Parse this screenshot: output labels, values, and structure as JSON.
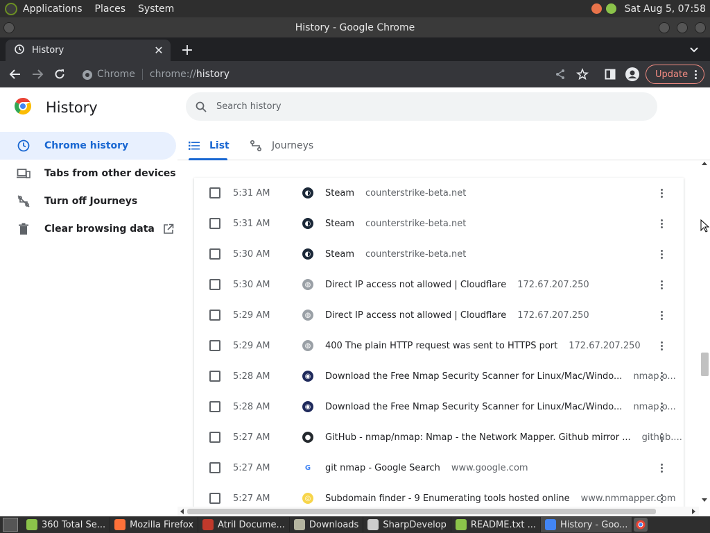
{
  "system_panel": {
    "menus": [
      "Applications",
      "Places",
      "System"
    ],
    "clock": "Sat Aug  5, 07:58"
  },
  "window": {
    "title": "History - Google Chrome"
  },
  "browser": {
    "tab_title": "History",
    "omnibox_chip": "Chrome",
    "url_prefix": "chrome://",
    "url_host": "history",
    "update_label": "Update"
  },
  "page": {
    "title": "History",
    "search_placeholder": "Search history",
    "sidebar": [
      {
        "label": "Chrome history"
      },
      {
        "label": "Tabs from other devices"
      },
      {
        "label": "Turn off Journeys"
      },
      {
        "label": "Clear browsing data"
      }
    ],
    "tabs": [
      {
        "label": "List"
      },
      {
        "label": "Journeys"
      }
    ],
    "entries": [
      {
        "time": "5:31 AM",
        "title": "Steam",
        "domain": "counterstrike-beta.net",
        "favicon": "steam-icon"
      },
      {
        "time": "5:31 AM",
        "title": "Steam",
        "domain": "counterstrike-beta.net",
        "favicon": "steam-icon"
      },
      {
        "time": "5:30 AM",
        "title": "Steam",
        "domain": "counterstrike-beta.net",
        "favicon": "steam-icon"
      },
      {
        "time": "5:30 AM",
        "title": "Direct IP access not allowed | Cloudflare",
        "domain": "172.67.207.250",
        "favicon": "globe-icon"
      },
      {
        "time": "5:29 AM",
        "title": "Direct IP access not allowed | Cloudflare",
        "domain": "172.67.207.250",
        "favicon": "globe-icon"
      },
      {
        "time": "5:29 AM",
        "title": "400 The plain HTTP request was sent to HTTPS port",
        "domain": "172.67.207.250",
        "favicon": "globe-icon"
      },
      {
        "time": "5:28 AM",
        "title": "Download the Free Nmap Security Scanner for Linux/Mac/Windo...",
        "domain": "nmap.o...",
        "favicon": "nmap-eye-icon"
      },
      {
        "time": "5:28 AM",
        "title": "Download the Free Nmap Security Scanner for Linux/Mac/Windo...",
        "domain": "nmap.o...",
        "favicon": "nmap-eye-icon"
      },
      {
        "time": "5:27 AM",
        "title": "GitHub - nmap/nmap: Nmap - the Network Mapper. Github mirror ...",
        "domain": "github....",
        "favicon": "github-icon"
      },
      {
        "time": "5:27 AM",
        "title": "git nmap - Google Search",
        "domain": "www.google.com",
        "favicon": "google-icon"
      },
      {
        "time": "5:27 AM",
        "title": "Subdomain finder - 9 Enumerating tools hosted online",
        "domain": "www.nmmapper.com",
        "favicon": "nmmapper-icon"
      }
    ]
  },
  "taskbar": [
    {
      "label": "360 Total Se...",
      "color": "#8bc34a"
    },
    {
      "label": "Mozilla Firefox",
      "color": "#ff7139"
    },
    {
      "label": "Atril Docume...",
      "color": "#c0392b"
    },
    {
      "label": "Downloads",
      "color": "#b5b5a0"
    },
    {
      "label": "SharpDevelop",
      "color": "#cccccc"
    },
    {
      "label": "README.txt ...",
      "color": "#8bc34a"
    },
    {
      "label": "History - Goo...",
      "color": "#4285f4"
    }
  ],
  "colors": {
    "accent": "#1967d2",
    "update_border": "#f28b82"
  }
}
